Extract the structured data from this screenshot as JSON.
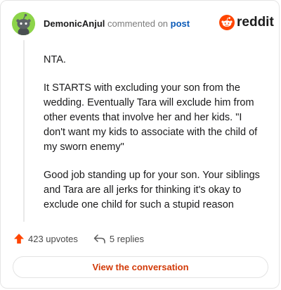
{
  "header": {
    "username": "DemonicAnjul",
    "action_text": "commented on",
    "post_link": "post",
    "brand_word": "reddit"
  },
  "comment": {
    "paragraphs": [
      "NTA.",
      "It STARTS with excluding your son from the wedding. Eventually Tara will exclude him from other events that involve her and her kids. \"I don't want my kids to associate with the child of my sworn enemy\"",
      "Good job standing up for your son. Your siblings and Tara are all jerks for thinking it's okay to exclude one child for such a stupid reason"
    ]
  },
  "actions": {
    "upvotes": "423 upvotes",
    "replies": "5 replies"
  },
  "footer": {
    "view_label": "View the conversation"
  },
  "colors": {
    "avatar_bg": "#8dd44a",
    "reddit_orange": "#ff4500",
    "link_blue": "#0a5ab8",
    "cta_text": "#d23a08"
  },
  "icons": {
    "avatar": "snoo-avatar",
    "logo": "reddit-snoo-icon",
    "upvote": "upvote-arrow-icon",
    "reply": "reply-arrow-icon"
  }
}
